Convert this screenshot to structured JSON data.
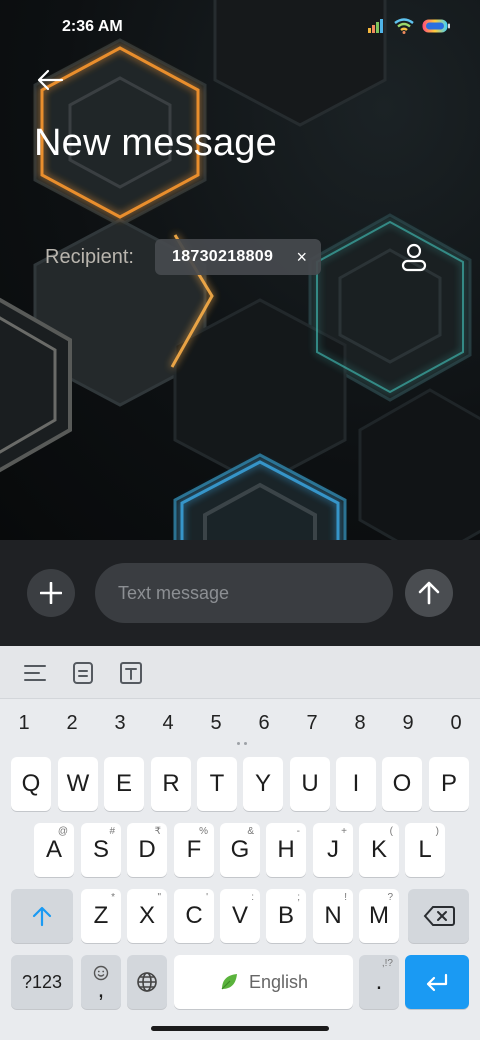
{
  "status_bar": {
    "time": "2:36 AM",
    "icons": [
      "signal-icon",
      "wifi-icon",
      "battery-icon"
    ]
  },
  "header": {
    "title": "New message",
    "back_icon": "arrow-left-icon"
  },
  "recipient": {
    "label": "Recipient:",
    "chip_value": "18730218809",
    "chip_remove": "×",
    "contact_icon": "person-icon"
  },
  "composer": {
    "placeholder": "Text message",
    "add_icon": "plus-icon",
    "send_icon": "arrow-up-icon"
  },
  "keyboard": {
    "toolbar_icons": [
      "align-icon",
      "clipboard-icon",
      "text-box-icon"
    ],
    "number_row": [
      "1",
      "2",
      "3",
      "4",
      "5",
      "6",
      "7",
      "8",
      "9",
      "0"
    ],
    "row1": [
      {
        "key": "Q",
        "hint": ""
      },
      {
        "key": "W",
        "hint": ""
      },
      {
        "key": "E",
        "hint": ""
      },
      {
        "key": "R",
        "hint": ""
      },
      {
        "key": "T",
        "hint": ""
      },
      {
        "key": "Y",
        "hint": ""
      },
      {
        "key": "U",
        "hint": ""
      },
      {
        "key": "I",
        "hint": ""
      },
      {
        "key": "O",
        "hint": ""
      },
      {
        "key": "P",
        "hint": ""
      }
    ],
    "row2": [
      {
        "key": "A",
        "hint": "@"
      },
      {
        "key": "S",
        "hint": "#"
      },
      {
        "key": "D",
        "hint": "₹"
      },
      {
        "key": "F",
        "hint": "%"
      },
      {
        "key": "G",
        "hint": "&"
      },
      {
        "key": "H",
        "hint": "-"
      },
      {
        "key": "J",
        "hint": "+"
      },
      {
        "key": "K",
        "hint": "("
      },
      {
        "key": "L",
        "hint": ")"
      }
    ],
    "row3": [
      {
        "key": "Z",
        "hint": "*"
      },
      {
        "key": "X",
        "hint": "\""
      },
      {
        "key": "C",
        "hint": "'"
      },
      {
        "key": "V",
        "hint": ":"
      },
      {
        "key": "B",
        "hint": ";"
      },
      {
        "key": "N",
        "hint": "!"
      },
      {
        "key": "M",
        "hint": "?"
      }
    ],
    "symbols_label": "?123",
    "comma_label": ",",
    "space_label": "English",
    "period_label": ".",
    "period_hint": ",!?",
    "shift_icon": "shift-icon",
    "delete_icon": "backspace-icon",
    "emoji_icon": "emoji-icon",
    "globe_icon": "globe-icon",
    "leaf_icon": "leaf-icon",
    "enter_icon": "enter-icon"
  },
  "colors": {
    "accent": "#1a9af3",
    "keyboard_bg": "#e9ebee",
    "composer_bg": "#1f2124"
  }
}
